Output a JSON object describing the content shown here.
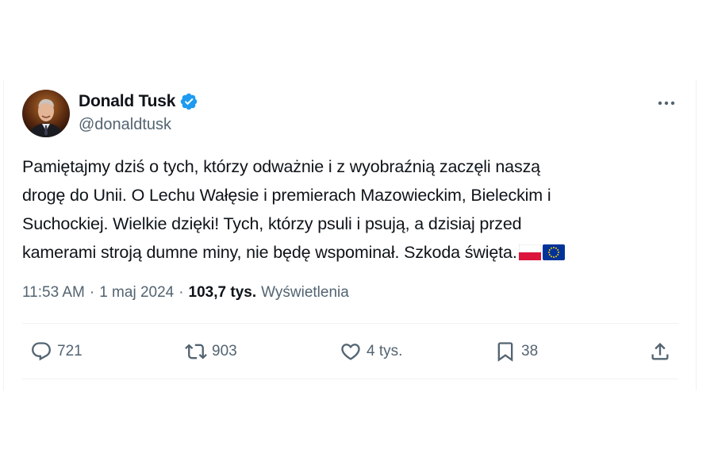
{
  "author": {
    "display_name": "Donald Tusk",
    "handle": "@donaldtusk",
    "verified": true,
    "avatar_icon": "avatar-photo"
  },
  "tweet": {
    "lines": [
      "Pamiętajmy dziś o tych, którzy odważnie i z wyobraźnią zaczęli naszą",
      "drogę do Unii. O Lechu Wałęsie i premierach Mazowieckim, Bieleckim i",
      "Suchockiej. Wielkie dzięki! Tych, którzy psuli  i psują, a dzisiaj przed",
      "kamerami stroją dumne miny, nie będę wspominał. Szkoda święta."
    ],
    "trailing_emoji": [
      "flag-poland",
      "flag-eu"
    ]
  },
  "meta": {
    "time": "11:53 AM",
    "separator": "·",
    "date": "1 maj 2024",
    "views_count": "103,7 tys.",
    "views_label": "Wyświetlenia"
  },
  "actions": {
    "replies": "721",
    "reposts": "903",
    "likes": "4 tys.",
    "bookmarks": "38"
  },
  "colors": {
    "verified_badge": "#1d9bf0",
    "secondary_text": "#536471",
    "primary_text": "#0f1419",
    "divider": "#eff3f4"
  }
}
